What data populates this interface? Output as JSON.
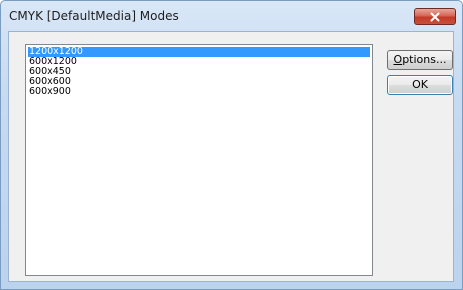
{
  "window": {
    "title": "CMYK [DefaultMedia] Modes"
  },
  "modes_list": {
    "items": [
      "1200x1200",
      "600x1200",
      "600x450",
      "600x600",
      "600x900"
    ],
    "selected": "1200x1200"
  },
  "buttons": {
    "options_label": "Options...",
    "options_mnemonic": "O",
    "options_rest": "ptions...",
    "ok_label": "OK"
  },
  "colors": {
    "selection": "#3399ff",
    "close_button": "#c33b28",
    "title_bar": "#c7dbf1"
  },
  "icons": {
    "close": "close-icon"
  }
}
